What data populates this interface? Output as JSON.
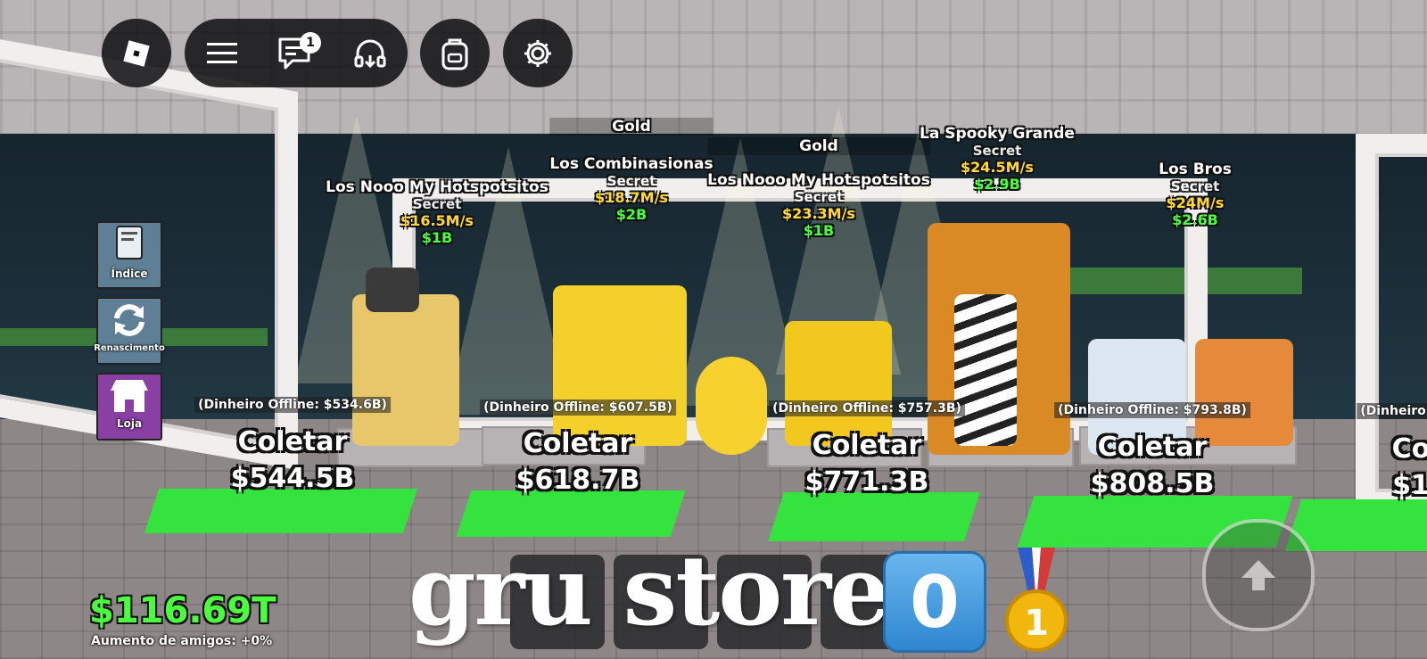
{
  "top_bar": {
    "chat_badge": "1",
    "icons": [
      "roblox-logo-icon",
      "menu-icon",
      "chat-icon",
      "voice-headset-icon",
      "backpack-icon",
      "settings-gear-icon"
    ]
  },
  "side_buttons": [
    {
      "label": "Índice",
      "icon": "book-icon",
      "color": "#5e7f95"
    },
    {
      "label": "Renascimento",
      "icon": "rebirth-arrows-icon",
      "color": "#5e7f95"
    },
    {
      "label": "Loja",
      "icon": "shop-icon",
      "color": "#8a3fa5"
    }
  ],
  "brainrots": [
    {
      "name": "Los Nooo My Hotspotsitos",
      "rarity": "Secret",
      "rate": "$16.5M/s",
      "price": "$1B"
    },
    {
      "name": "Los Combinasionas",
      "rarity": "Secret",
      "rate": "$18.7M/s",
      "price": "$2B",
      "mutation": "Gold"
    },
    {
      "name": "Los Nooo My Hotspotsitos",
      "rarity": "Secret",
      "rate": "$23.3M/s",
      "price": "$1B",
      "mutation": "Gold"
    },
    {
      "name": "La Spooky Grande",
      "rarity": "Secret",
      "rate": "$24.5M/s",
      "price": "$2.9B"
    },
    {
      "name": "Los Bros",
      "rarity": "Secret",
      "rate": "$24M/s",
      "price": "$2.6B"
    }
  ],
  "collect_pads": [
    {
      "offline": "(Dinheiro Offline: $534.6B)",
      "label": "Coletar",
      "amount": "$544.5B"
    },
    {
      "offline": "(Dinheiro Offline: $607.5B)",
      "label": "Coletar",
      "amount": "$618.7B"
    },
    {
      "offline": "(Dinheiro Offline: $757.3B)",
      "label": "Coletar",
      "amount": "$771.3B"
    },
    {
      "offline": "(Dinheiro Offline: $793.8B)",
      "label": "Coletar",
      "amount": "$808.5B"
    },
    {
      "offline": "(Dinheiro",
      "label": "Co",
      "amount": "$1"
    }
  ],
  "hud": {
    "money": "$116.69T",
    "friend_boost": "Aumento de amigos: +0%"
  },
  "watermark": {
    "text": "gru store",
    "keycap": "0",
    "medal": "1"
  },
  "colors": {
    "cash_green": "#4cff3e",
    "rate_yellow": "#ffd83a",
    "pad_green": "#35e33e"
  }
}
